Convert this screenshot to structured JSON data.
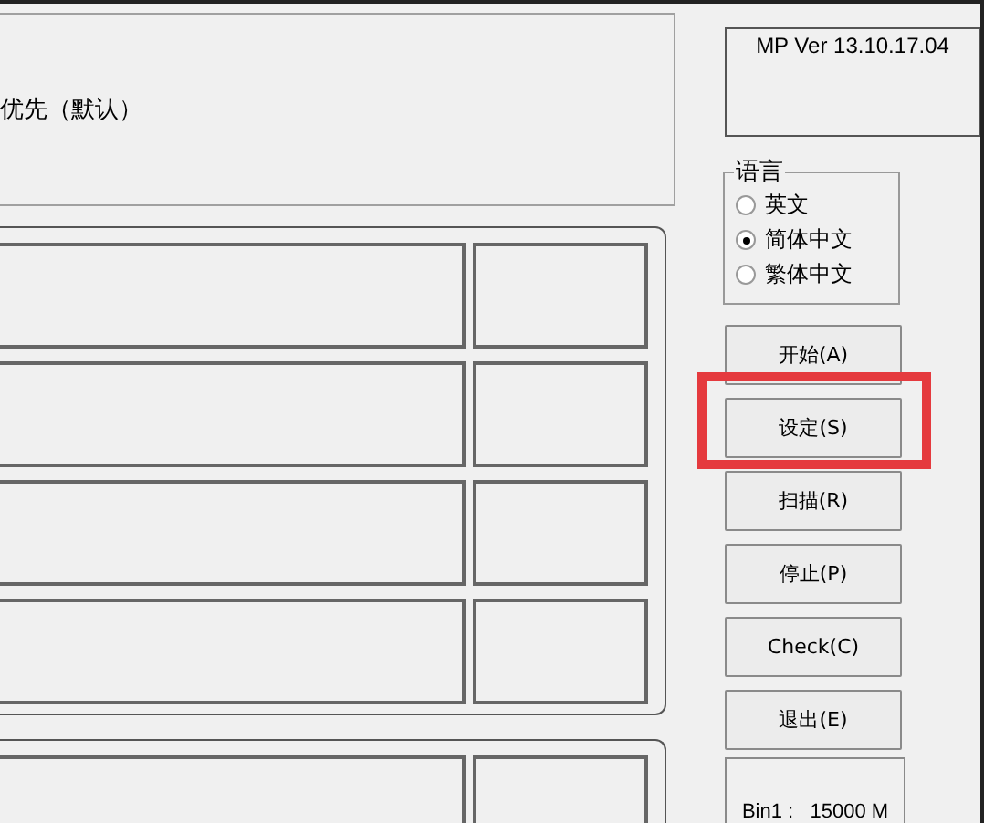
{
  "top_panel": {
    "text": "优先（默认）"
  },
  "version": "MP Ver 13.10.17.04",
  "language": {
    "title": "语言",
    "options": [
      {
        "label": "英文",
        "selected": false
      },
      {
        "label": "简体中文",
        "selected": true
      },
      {
        "label": "繁体中文",
        "selected": false
      }
    ]
  },
  "buttons": [
    {
      "label": "开始(A)",
      "highlighted": false
    },
    {
      "label": "设定(S)",
      "highlighted": true
    },
    {
      "label": "扫描(R)",
      "highlighted": false
    },
    {
      "label": "停止(P)",
      "highlighted": false
    },
    {
      "label": "Check(C)",
      "highlighted": false
    },
    {
      "label": "退出(E)",
      "highlighted": false
    }
  ],
  "bin_info": [
    "Bin1 :   15000 M"
  ]
}
